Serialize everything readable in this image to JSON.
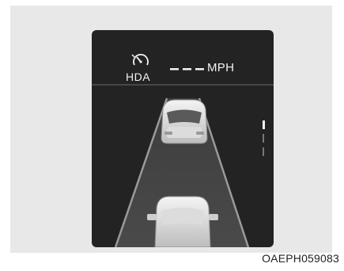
{
  "hda": {
    "label": "HDA",
    "icon": "hda-speedometer-icon"
  },
  "speed": {
    "value": "---",
    "unit": "MPH"
  },
  "figure_code": "OAEPH059083",
  "colors": {
    "cluster_background": "#232323",
    "frame_background": "#e8e8e8",
    "text": "#f2f2f2",
    "road": "#3a3a3a",
    "lane_line": "#cfcfcf"
  }
}
